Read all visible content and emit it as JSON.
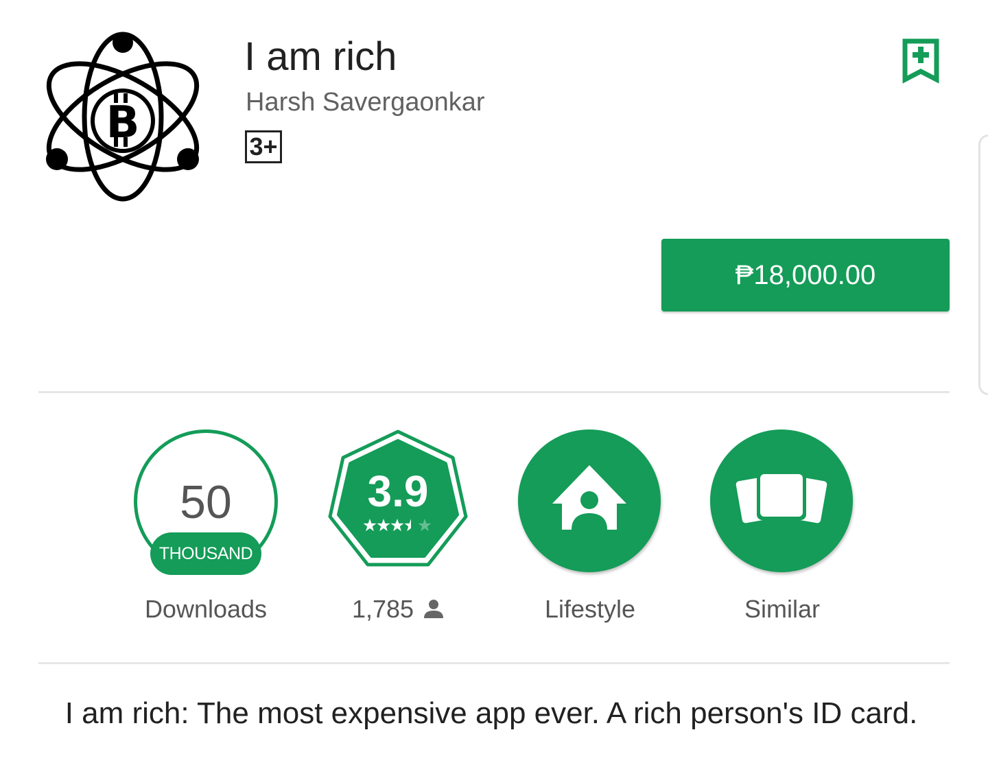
{
  "app": {
    "title": "I am rich",
    "developer": "Harsh Savergaonkar",
    "content_rating": "3+",
    "icon": "atom-bitcoin-icon",
    "wishlist_icon": "bookmark-plus-icon"
  },
  "buy_button": {
    "label": "₱18,000.00",
    "color": "#149c58"
  },
  "stats": {
    "downloads": {
      "number": "50",
      "unit": "THOUSAND",
      "label": "Downloads"
    },
    "rating": {
      "value": "3.9",
      "stars": 3.9,
      "count": "1,785",
      "count_icon": "person-icon"
    },
    "category": {
      "label": "Lifestyle",
      "icon": "house-person-icon"
    },
    "similar": {
      "label": "Similar",
      "icon": "stacked-cards-icon"
    }
  },
  "description": "I am rich: The most expensive app ever. A rich person's ID card.",
  "colors": {
    "accent": "#149c58",
    "text_primary": "#212121",
    "text_secondary": "#616161",
    "divider": "#e6e6e6"
  }
}
